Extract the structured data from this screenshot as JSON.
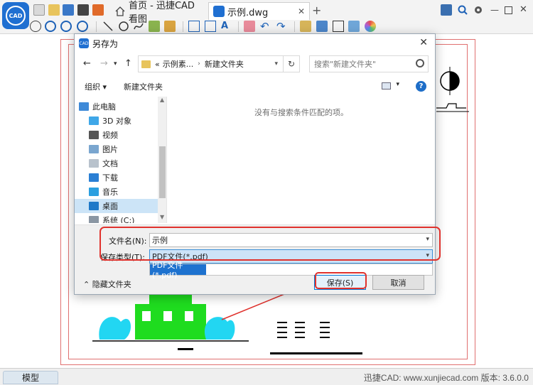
{
  "tabs": {
    "home": "首页 - 迅捷CAD看图",
    "doc": "示例.dwg"
  },
  "bottom": {
    "model_tab": "模型",
    "version": "迅捷CAD: www.xunjiecad.com 版本: 3.6.0.0"
  },
  "dialog": {
    "title": "另存为",
    "breadcrumb": [
      "«",
      "示例素...",
      "新建文件夹"
    ],
    "search_placeholder": "搜索\"新建文件夹\"",
    "organize": "组织 ▾",
    "new_folder": "新建文件夹",
    "tree": [
      "此电脑",
      "3D 对象",
      "视频",
      "图片",
      "文档",
      "下载",
      "音乐",
      "桌面",
      "系统 (C:)"
    ],
    "empty_message": "没有与搜索条件匹配的项。",
    "filename_label": "文件名(N):",
    "filename_value": "示例",
    "filetype_label": "保存类型(T):",
    "filetype_value": "PDF文件(*.pdf)",
    "filetype_option": "PDF文件(*.pdf)",
    "hide_folders": "隐藏文件夹",
    "save_button": "保存(S)",
    "cancel_button": "取消"
  },
  "colors": {
    "accent": "#1f6fd1",
    "highlight": "#e0322d"
  }
}
